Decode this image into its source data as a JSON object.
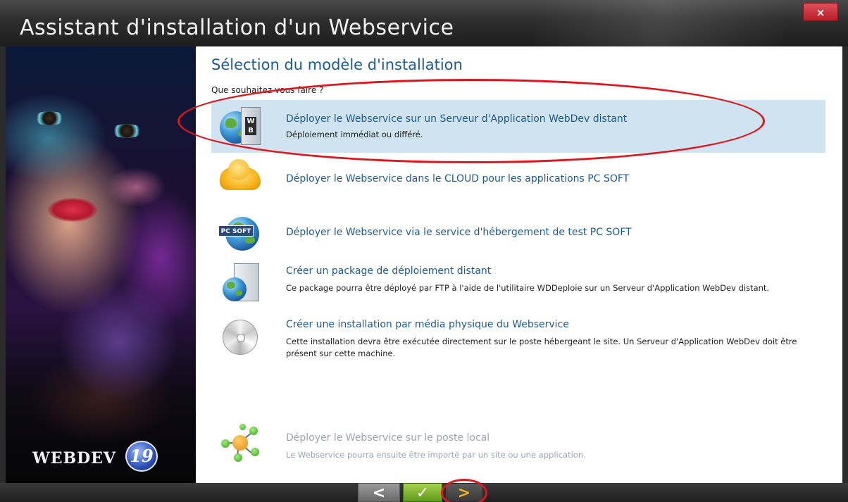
{
  "window": {
    "title": "Assistant d'installation d'un Webservice",
    "close_label": "×"
  },
  "branding": {
    "logo_text": "WEBDEV",
    "version_badge": "19"
  },
  "page": {
    "title": "Sélection du modèle d'installation",
    "question": "Que souhaitez-vous faire ?"
  },
  "options": [
    {
      "title": "Déployer le Webservice sur un Serveur d'Application WebDev distant",
      "description": "Déploiement immédiat ou différé.",
      "icon": "globe-server-wb-icon",
      "selected": true,
      "enabled": true
    },
    {
      "title": "Déployer le Webservice dans le CLOUD pour les applications PC SOFT",
      "description": "",
      "icon": "cloud-icon",
      "selected": false,
      "enabled": true
    },
    {
      "title": "Déployer le Webservice via le service d'hébergement de test PC SOFT",
      "description": "",
      "icon": "pcsoft-globe-icon",
      "badge": "PC SOFT",
      "selected": false,
      "enabled": true
    },
    {
      "title": "Créer un package de déploiement distant",
      "description": "Ce package pourra être déployé par FTP à l'aide de l'utilitaire WDDeploie sur un Serveur d'Application WebDev distant.",
      "icon": "package-globe-icon",
      "selected": false,
      "enabled": true
    },
    {
      "title": "Créer une installation par média physique du Webservice",
      "description": "Cette installation devra être exécutée directement sur le poste hébergeant le site. Un Serveur d'Application WebDev doit être présent sur cette machine.",
      "icon": "cd-icon",
      "selected": false,
      "enabled": true
    },
    {
      "title": "Déployer le Webservice sur le poste local",
      "description": "Le Webservice pourra ensuite être importé par un site ou une application.",
      "icon": "network-nodes-icon",
      "selected": false,
      "enabled": false
    }
  ],
  "nav": {
    "back_label": "<",
    "finish_label": "✓",
    "next_label": ">"
  },
  "colors": {
    "accent_text": "#1e5a8c",
    "selected_bg": "#cfe3f0",
    "annotation": "#e0141c"
  }
}
